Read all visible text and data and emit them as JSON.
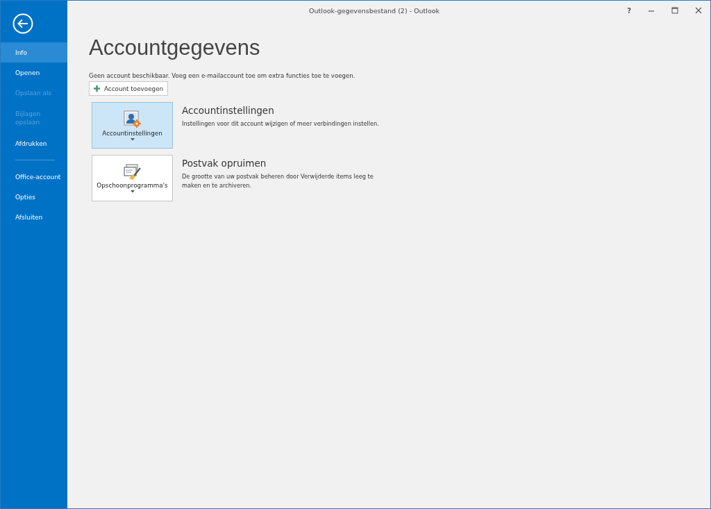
{
  "window": {
    "title": "Outlook-gegevensbestand (2) - Outlook",
    "help": "?"
  },
  "sidebar": {
    "groups": [
      {
        "items": [
          {
            "label": "Info",
            "selected": true,
            "disabled": false
          },
          {
            "label": "Openen",
            "selected": false,
            "disabled": false
          },
          {
            "label": "Opslaan als",
            "selected": false,
            "disabled": true
          },
          {
            "label": "Bijlagen opslaan",
            "selected": false,
            "disabled": true
          },
          {
            "label": "Afdrukken",
            "selected": false,
            "disabled": false
          }
        ]
      },
      {
        "items": [
          {
            "label": "Office-account",
            "selected": false,
            "disabled": false
          },
          {
            "label": "Opties",
            "selected": false,
            "disabled": false
          },
          {
            "label": "Afsluiten",
            "selected": false,
            "disabled": false
          }
        ]
      }
    ]
  },
  "page": {
    "heading": "Accountgegevens",
    "notice": "Geen account beschikbaar. Voeg een e-mailaccount toe om extra functies toe te voegen.",
    "add_button": "Account toevoegen"
  },
  "sections": [
    {
      "kind": "account",
      "button": "Accountinstellingen",
      "selected": true,
      "title": "Accountinstellingen",
      "description": "Instellingen voor dit account wijzigen of meer verbindingen instellen."
    },
    {
      "kind": "cleanup",
      "button": "Opschoonprogramma's",
      "selected": false,
      "title": "Postvak opruimen",
      "description": "De grootte van uw postvak beheren door Verwijderde items leeg te maken en te archiveren."
    }
  ]
}
